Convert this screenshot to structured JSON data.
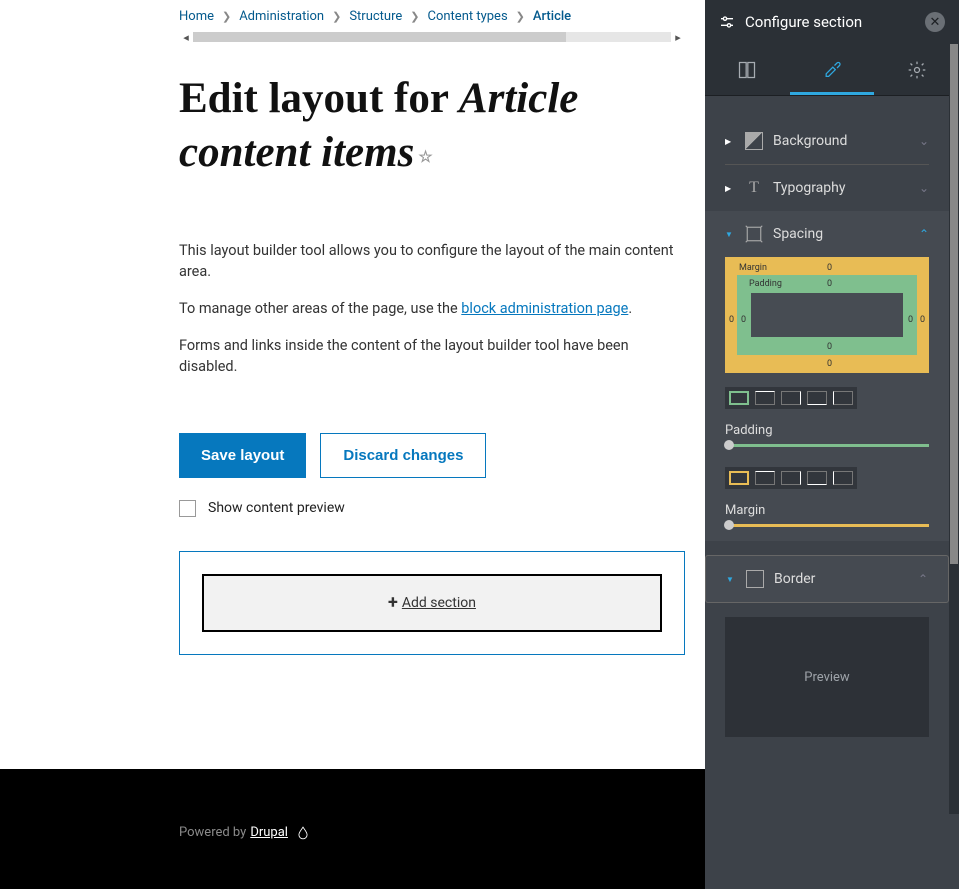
{
  "breadcrumb": {
    "items": [
      "Home",
      "Administration",
      "Structure",
      "Content types"
    ],
    "current": "Article"
  },
  "title": {
    "prefix": "Edit layout for ",
    "italic": "Article content items"
  },
  "description": {
    "p1": "This layout builder tool allows you to configure the layout of the main content area.",
    "p2_before": "To manage other areas of the page, use the ",
    "p2_link": "block administration page",
    "p2_after": ".",
    "p3": "Forms and links inside the content of the layout builder tool have been disabled."
  },
  "actions": {
    "save": "Save layout",
    "discard": "Discard changes"
  },
  "preview_checkbox": "Show content preview",
  "add_section": "Add section",
  "footer": {
    "powered": "Powered by ",
    "drupal": "Drupal"
  },
  "panel": {
    "title": "Configure section",
    "groups": {
      "background": "Background",
      "typography": "Typography",
      "spacing": "Spacing",
      "border": "Border"
    },
    "spacing": {
      "margin_label": "Margin",
      "padding_label": "Padding",
      "zero": "0"
    },
    "sliders": {
      "padding": "Padding",
      "margin": "Margin"
    },
    "preview": "Preview"
  }
}
